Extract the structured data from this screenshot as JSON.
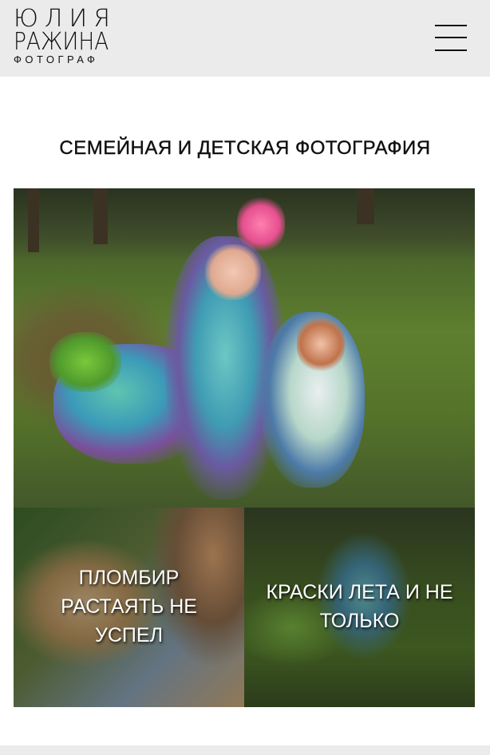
{
  "header": {
    "logo": {
      "line1": "ЮЛИЯ",
      "line2": "РАЖИНА",
      "line3": "ФОТОГРАФ"
    },
    "menu_icon": "hamburger-menu-icon"
  },
  "page": {
    "title": "СЕМЕЙНАЯ И ДЕТСКАЯ ФОТОГРАФИЯ"
  },
  "gallery": {
    "tiles": [
      {
        "caption": "ПЛОМБИР РАСТАЯТЬ НЕ УСПЕЛ"
      },
      {
        "caption": "КРАСКИ ЛЕТА И НЕ ТОЛЬКО"
      }
    ]
  },
  "colors": {
    "header_bg": "#ebebeb",
    "text": "#111111",
    "caption_text": "#ffffff"
  }
}
